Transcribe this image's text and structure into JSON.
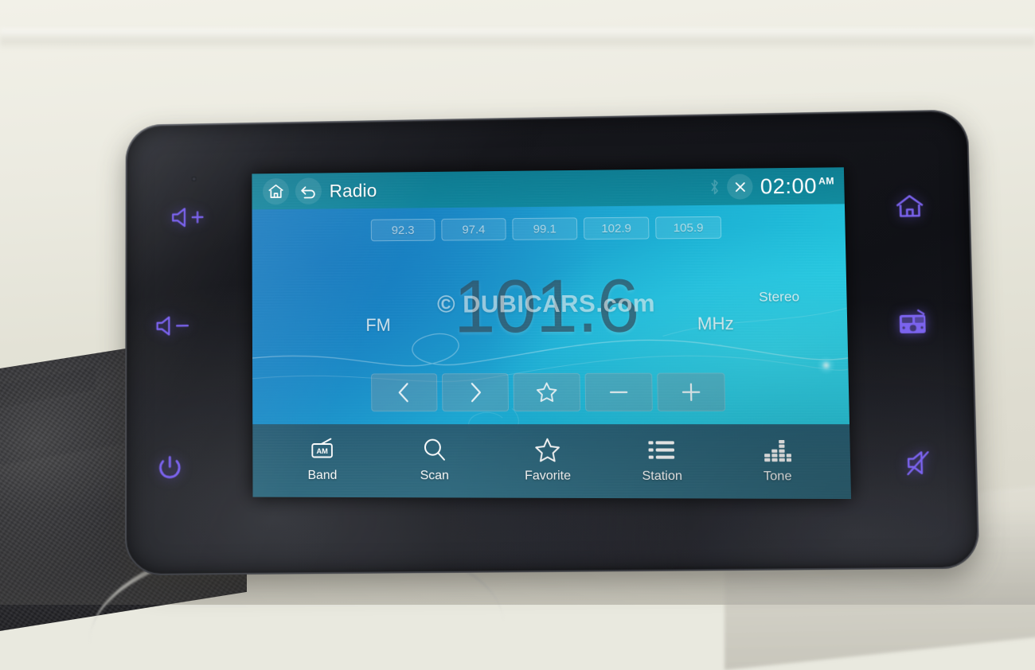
{
  "device": {
    "name": "car-infotainment-head-unit",
    "accent_purple": "#7b63ee",
    "screen_accent": "#19b2d6",
    "header_teal": "#0b8496"
  },
  "header": {
    "home_icon": "home-icon",
    "back_icon": "back-arrow-icon",
    "title": "Radio",
    "bluetooth_icon": "bluetooth-icon",
    "close_icon": "close-icon",
    "time": "02:00",
    "meridiem": "AM"
  },
  "presets": [
    {
      "label": "92.3"
    },
    {
      "label": "97.4"
    },
    {
      "label": "99.1"
    },
    {
      "label": "102.9"
    },
    {
      "label": "105.9"
    }
  ],
  "tuner": {
    "band": "FM",
    "frequency": "101.6",
    "unit": "MHz",
    "stereo": "Stereo",
    "watermark": "© DUBICARS.com"
  },
  "controls": [
    {
      "name": "previous-station-button",
      "icon": "chevron-left-icon"
    },
    {
      "name": "next-station-button",
      "icon": "chevron-right-icon"
    },
    {
      "name": "favorite-button",
      "icon": "star-icon"
    },
    {
      "name": "tune-down-button",
      "icon": "minus-icon"
    },
    {
      "name": "tune-up-button",
      "icon": "plus-icon"
    }
  ],
  "nav": [
    {
      "label": "Band",
      "icon": "am-radio-icon",
      "badge": "AM"
    },
    {
      "label": "Scan",
      "icon": "search-icon"
    },
    {
      "label": "Favorite",
      "icon": "star-icon"
    },
    {
      "label": "Station",
      "icon": "list-icon"
    },
    {
      "label": "Tone",
      "icon": "equalizer-icon"
    }
  ],
  "bezel_buttons": [
    {
      "name": "volume-up-button",
      "icon": "volume-up-icon"
    },
    {
      "name": "volume-down-button",
      "icon": "volume-down-icon"
    },
    {
      "name": "power-button",
      "icon": "power-icon"
    },
    {
      "name": "home-button",
      "icon": "home-icon"
    },
    {
      "name": "radio-button",
      "icon": "radio-icon"
    },
    {
      "name": "mute-button",
      "icon": "mute-icon"
    }
  ]
}
